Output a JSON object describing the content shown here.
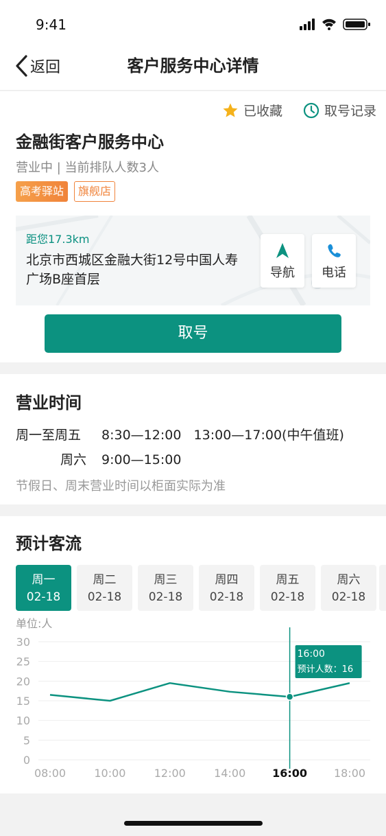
{
  "status_bar": {
    "time": "9:41"
  },
  "nav": {
    "back_label": "返回",
    "title": "客户服务中心详情"
  },
  "actions": {
    "favorite": "已收藏",
    "ticket_history": "取号记录"
  },
  "center": {
    "name": "金融街客户服务中心",
    "status": "营业中 | 当前排队人数3人",
    "tags": [
      "高考驿站",
      "旗舰店"
    ],
    "distance": "距您17.3km",
    "address": "北京市西城区金融大街12号中国人寿广场B座首层",
    "nav_button": "导航",
    "call_button": "电话",
    "take_number_button": "取号"
  },
  "hours": {
    "title": "营业时间",
    "rows": [
      {
        "day": "周一至周五",
        "time": "8:30—12:00   13:00—17:00(中午值班)"
      },
      {
        "day": "周六",
        "time": "9:00—15:00"
      }
    ],
    "note": "节假日、周末营业时间以柜面实际为准"
  },
  "flow": {
    "title": "预计客流",
    "days": [
      {
        "weekday": "周一",
        "date": "02-18"
      },
      {
        "weekday": "周二",
        "date": "02-18"
      },
      {
        "weekday": "周三",
        "date": "02-18"
      },
      {
        "weekday": "周四",
        "date": "02-18"
      },
      {
        "weekday": "周五",
        "date": "02-18"
      },
      {
        "weekday": "周六",
        "date": "02-18"
      }
    ],
    "selected_day": 0
  },
  "chart_data": {
    "type": "line",
    "unit_label": "单位:人",
    "x": [
      "08:00",
      "10:00",
      "12:00",
      "14:00",
      "16:00",
      "18:00"
    ],
    "series": [
      {
        "values": [
          16.5,
          15,
          19.5,
          17.3,
          16,
          19.5
        ]
      }
    ],
    "ylim": [
      0,
      30
    ],
    "yticks": [
      0,
      5,
      10,
      15,
      20,
      25,
      30
    ],
    "grid": true,
    "selected_index": 4,
    "tooltip": {
      "time": "16:00",
      "label": "预计人数：16"
    },
    "color": "#0c9280"
  },
  "colors": {
    "accent": "#0c9280",
    "tag_orange": "#f0833a",
    "favorite_star": "#f5b21b"
  }
}
